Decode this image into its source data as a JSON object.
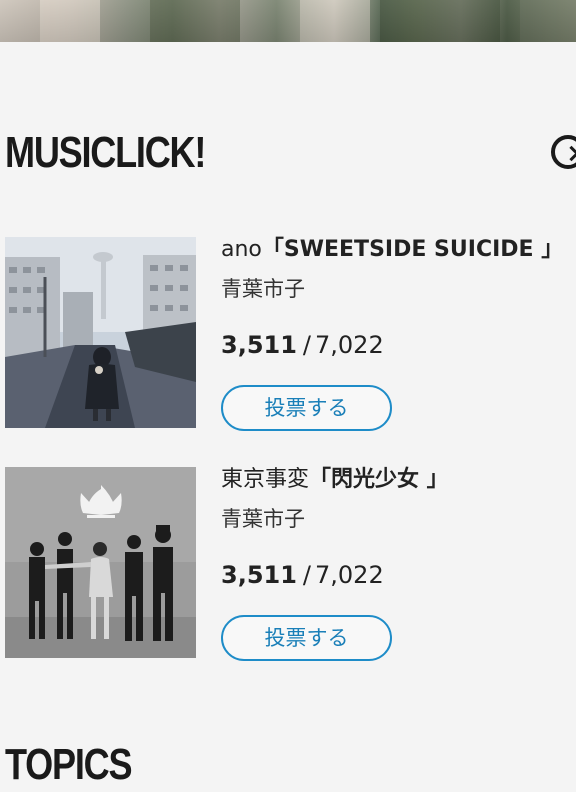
{
  "section": {
    "title": "MUSICLICK!"
  },
  "items": [
    {
      "artist": "ano",
      "song": "「SWEETSIDE SUICIDE 」",
      "submitter": "青葉市子",
      "votes_current": "3,511",
      "votes_separator": "/",
      "votes_total": "7,022",
      "button_label": "投票する",
      "artwork": "ano-sweetside-suicide-cover"
    },
    {
      "artist": "東京事変",
      "song": "「閃光少女 」",
      "submitter": "青葉市子",
      "votes_current": "3,511",
      "votes_separator": "/",
      "votes_total": "7,022",
      "button_label": "投票する",
      "artwork": "tokyo-jihen-senkou-shoujo-cover"
    }
  ],
  "topics": {
    "title": "TOPICS"
  },
  "icons": {
    "more": "chevron-right-circle-icon"
  },
  "colors": {
    "accent": "#1e8cc8",
    "background": "#f4f4f4",
    "text": "#222222"
  }
}
